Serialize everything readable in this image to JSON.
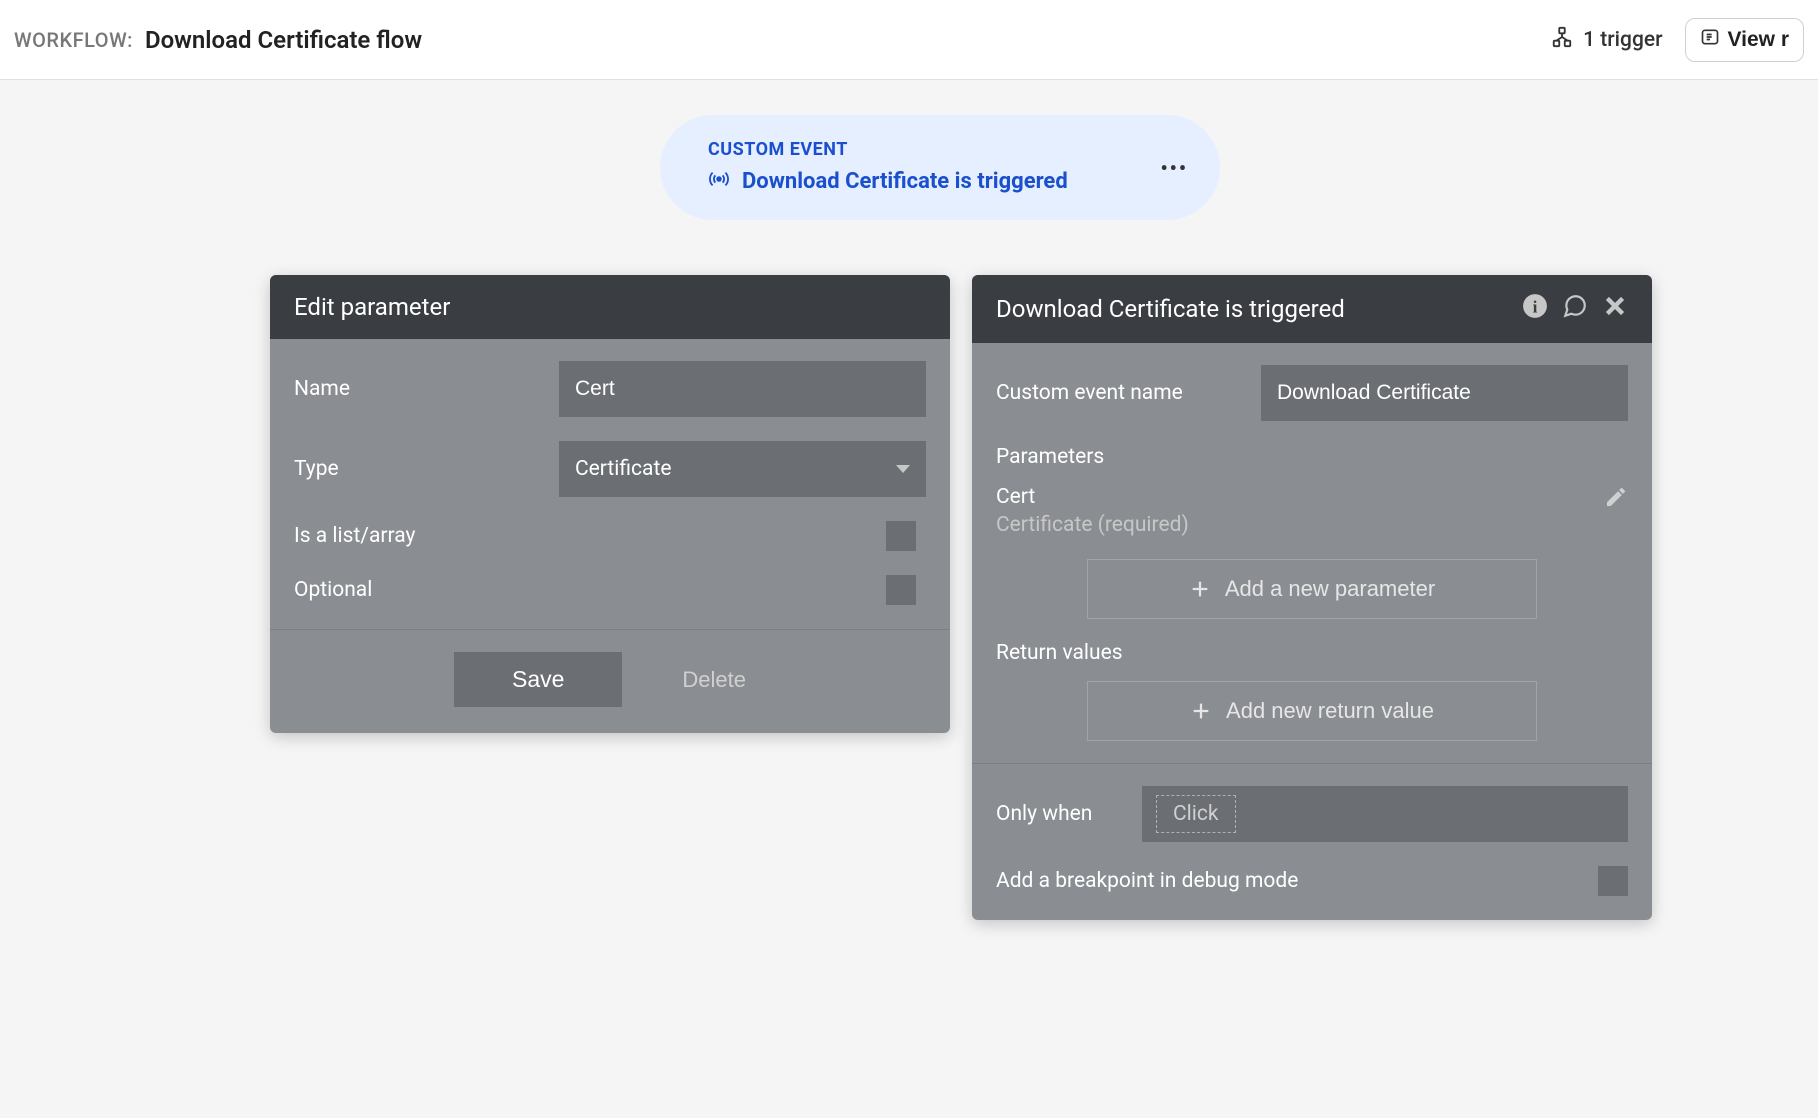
{
  "header": {
    "workflow_label": "WORKFLOW:",
    "workflow_name": "Download Certificate flow",
    "trigger_count": "1 trigger",
    "view_button": "View r"
  },
  "event_pill": {
    "category": "CUSTOM EVENT",
    "title": "Download Certificate is triggered"
  },
  "edit_panel": {
    "title": "Edit parameter",
    "rows": {
      "name_label": "Name",
      "name_value": "Cert",
      "type_label": "Type",
      "type_value": "Certificate",
      "list_label": "Is a list/array",
      "optional_label": "Optional"
    },
    "footer": {
      "save": "Save",
      "delete": "Delete"
    }
  },
  "event_panel": {
    "title": "Download Certificate is triggered",
    "custom_event_label": "Custom event name",
    "custom_event_value": "Download Certificate",
    "parameters_label": "Parameters",
    "param_item": {
      "name": "Cert",
      "sub": "Certificate (required)"
    },
    "add_param_button": "Add a new parameter",
    "return_values_label": "Return values",
    "add_return_button": "Add new return value",
    "only_when_label": "Only when",
    "only_when_chip": "Click",
    "breakpoint_label": "Add a breakpoint in debug mode"
  }
}
